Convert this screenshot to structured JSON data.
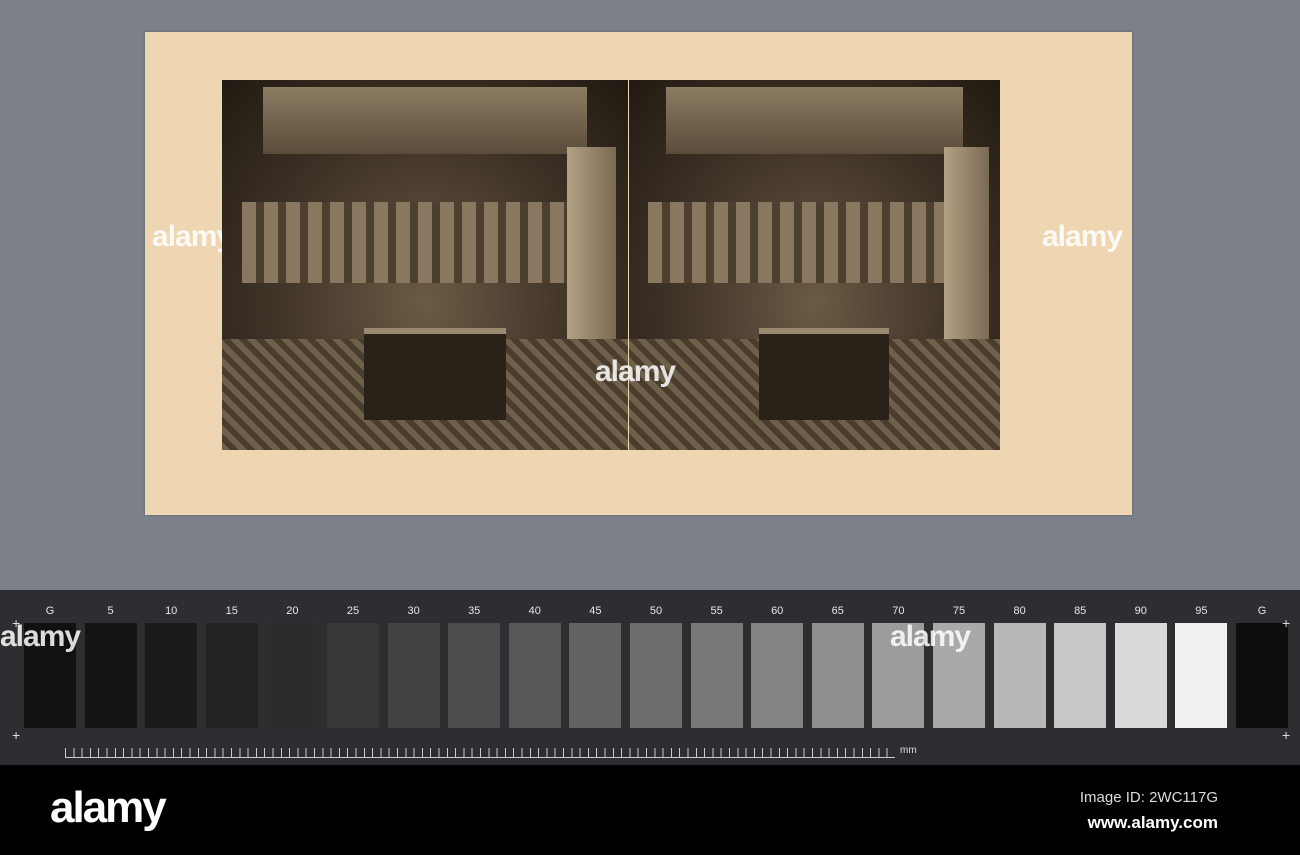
{
  "watermark": "alamy",
  "watermark_short": "a",
  "calibration_strip": {
    "labels": [
      "G",
      "5",
      "10",
      "15",
      "20",
      "25",
      "30",
      "35",
      "40",
      "45",
      "50",
      "55",
      "60",
      "65",
      "70",
      "75",
      "80",
      "85",
      "90",
      "95",
      "G"
    ],
    "patch_colors": [
      "#111111",
      "#141414",
      "#1b1b1b",
      "#222222",
      "#2c2c2c",
      "#373737",
      "#424242",
      "#4c4c4c",
      "#575757",
      "#626262",
      "#6d6d6d",
      "#787878",
      "#848484",
      "#8f8f8f",
      "#9c9c9c",
      "#a9a9a9",
      "#b8b8b8",
      "#c8c8c8",
      "#d9d9d9",
      "#f0f0f0",
      "#0e0e0e"
    ],
    "unit": "mm"
  },
  "footer": {
    "logo": "alamy",
    "image_id": "Image ID: 2WC117G",
    "website": "www.alamy.com"
  }
}
